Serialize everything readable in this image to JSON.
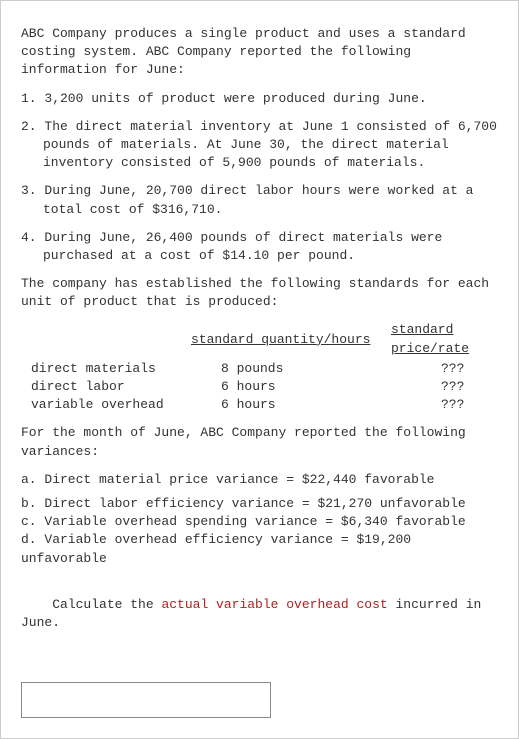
{
  "intro1": "ABC Company produces a single product and uses a standard costing system. ABC Company reported the following information for June:",
  "items": [
    "1. 3,200 units of product were produced during June.",
    "2. The direct material inventory at June 1 consisted of 6,700 pounds of materials. At June 30, the direct material inventory consisted of 5,900 pounds of materials.",
    "3. During June, 20,700 direct labor hours were worked at a total cost of $316,710.",
    "4. During June, 26,400 pounds of direct materials were purchased at a cost of $14.10 per pound."
  ],
  "standards_intro": "The company has established the following standards for each unit of product that is produced:",
  "table": {
    "headers": {
      "blank": "",
      "qty": "standard quantity/hours",
      "rate": "standard price/rate"
    },
    "rows": [
      {
        "label": "direct materials",
        "qty": "8 pounds",
        "rate": "???"
      },
      {
        "label": "direct labor",
        "qty": "6 hours",
        "rate": "???"
      },
      {
        "label": "variable overhead",
        "qty": "6 hours",
        "rate": "???"
      }
    ]
  },
  "variances_intro": "For the month of June, ABC Company reported the following variances:",
  "variances": [
    "a. Direct material price variance = $22,440 favorable",
    "b. Direct labor efficiency variance = $21,270 unfavorable",
    "c. Variable overhead spending variance = $6,340 favorable",
    "d. Variable overhead efficiency variance = $19,200 unfavorable"
  ],
  "prompt_prefix": "Calculate the ",
  "prompt_highlight": "actual variable overhead cost",
  "prompt_suffix": " incurred in June.",
  "answer_value": ""
}
